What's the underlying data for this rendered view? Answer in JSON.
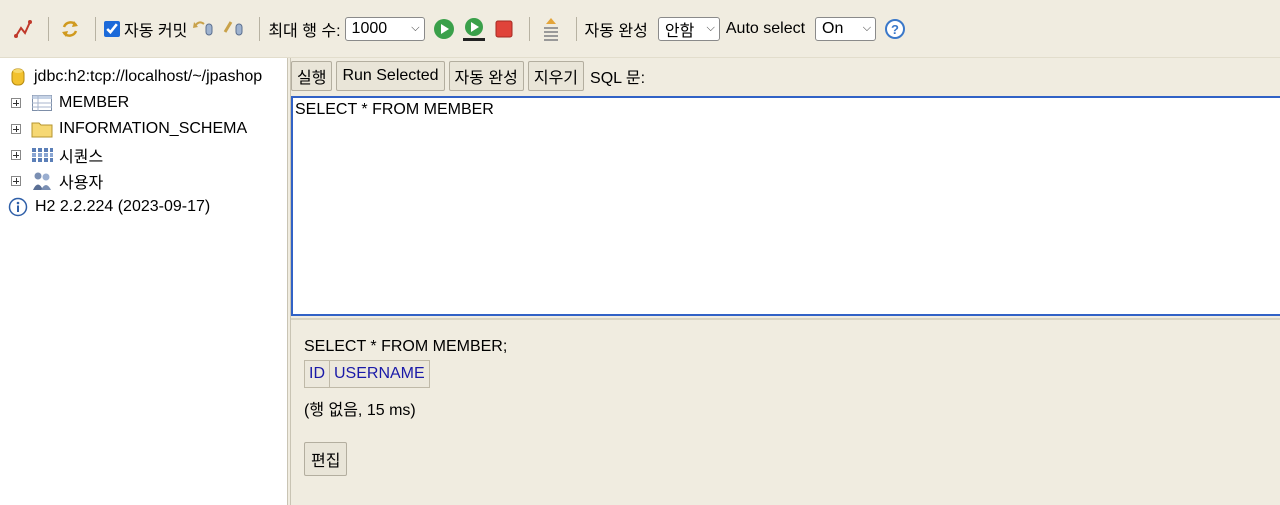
{
  "toolbar": {
    "auto_commit_label": "자동 커밋",
    "auto_commit_checked": true,
    "max_rows_label": "최대 행 수:",
    "max_rows_value": "1000",
    "auto_complete_label": "자동 완성",
    "auto_complete_value": "안함",
    "auto_select_label": "Auto select",
    "auto_select_value": "On",
    "help_glyph": "?",
    "icons": [
      "disconnect-icon",
      "refresh-icon",
      "rollback-icon",
      "commit-icon",
      "run-icon",
      "run-selected-icon",
      "stop-icon",
      "history-icon",
      "help-icon"
    ],
    "accent_color": "#1c6ad9"
  },
  "tree": {
    "connection": "jdbc:h2:tcp://localhost/~/jpashop",
    "nodes": [
      {
        "label": "MEMBER",
        "icon": "table-icon"
      },
      {
        "label": "INFORMATION_SCHEMA",
        "icon": "folder-icon"
      },
      {
        "label": "시퀀스",
        "icon": "sequence-icon"
      },
      {
        "label": "사용자",
        "icon": "users-icon"
      }
    ],
    "version": "H2 2.2.224 (2023-09-17)"
  },
  "query": {
    "buttons": {
      "run": "실행",
      "run_selected": "Run Selected",
      "auto_complete": "자동 완성",
      "clear": "지우기"
    },
    "sql_label": "SQL 문:",
    "sql_text": "SELECT * FROM MEMBER",
    "editor_border_color": "#3162c6"
  },
  "results": {
    "executed_query": "SELECT * FROM MEMBER;",
    "columns": [
      "ID",
      "USERNAME"
    ],
    "info": "(행 없음, 15 ms)",
    "edit_button": "편집",
    "header_color": "#1a1aa8"
  }
}
